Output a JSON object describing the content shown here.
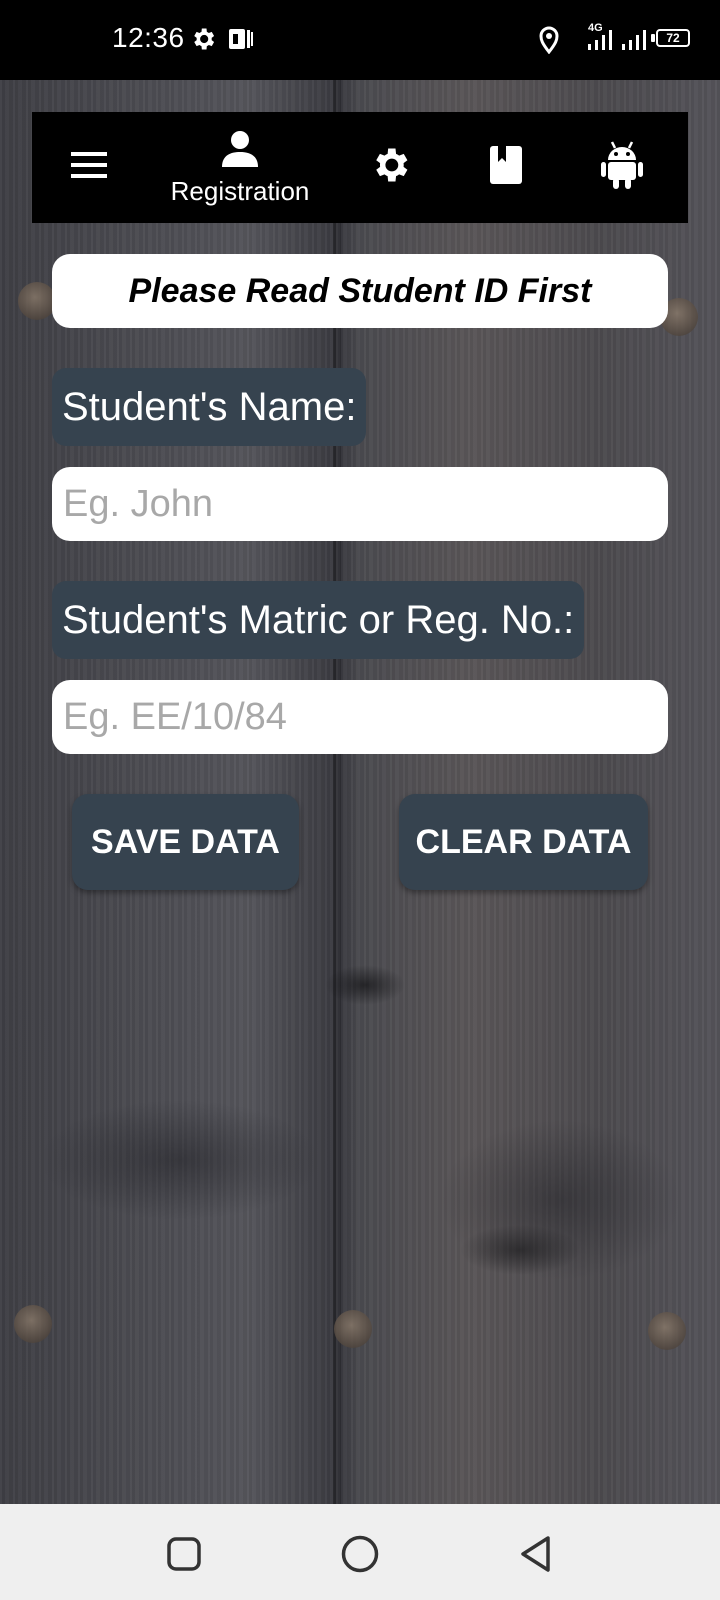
{
  "status_bar": {
    "time": "12:36",
    "battery": "72",
    "network": "4G",
    "icons": [
      "gear-icon",
      "app-badge-icon",
      "location-icon",
      "signal-icon",
      "signal-icon",
      "battery-icon"
    ]
  },
  "toolbar": {
    "items": [
      {
        "icon": "menu-icon"
      },
      {
        "icon": "person-icon",
        "label": "Registration"
      },
      {
        "icon": "gear-icon"
      },
      {
        "icon": "book-icon"
      },
      {
        "icon": "android-icon"
      }
    ]
  },
  "banner": {
    "text": "Please Read Student ID First"
  },
  "form": {
    "name_label": "Student's Name:",
    "name_placeholder": "Eg. John",
    "name_value": "",
    "matric_label": "Student's Matric or Reg. No.:",
    "matric_placeholder": "Eg. EE/10/84",
    "matric_value": ""
  },
  "actions": {
    "save_label": "SAVE DATA",
    "clear_label": "CLEAR DATA"
  },
  "nav_bar": {
    "buttons": [
      "recents-square-icon",
      "home-circle-icon",
      "back-triangle-icon"
    ]
  },
  "colors": {
    "label_bg": "#36434f",
    "toolbar_bg": "#000000",
    "nav_bg": "#efefef"
  }
}
